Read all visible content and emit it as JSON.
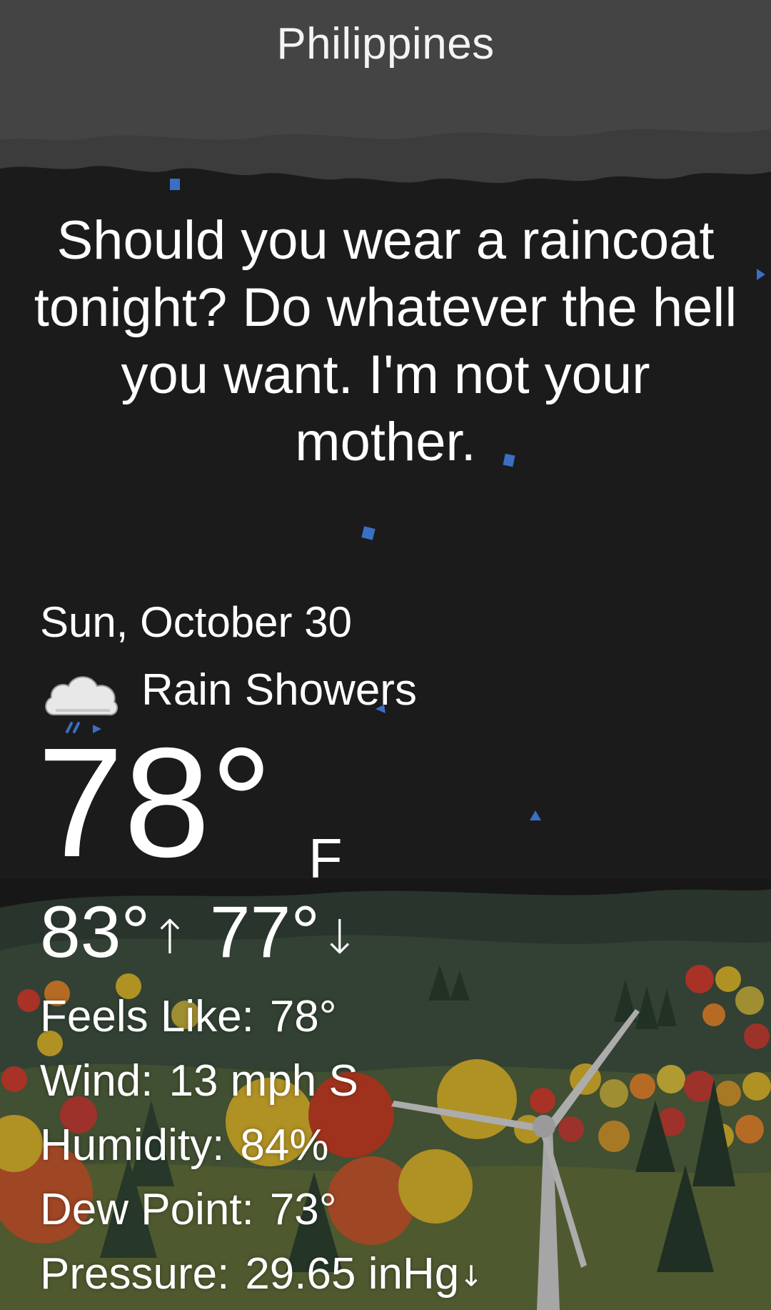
{
  "location": "Philippines",
  "headline": "Should you wear a raincoat tonight? Do whatever the hell you want. I'm not your mother.",
  "date": "Sun, October 30",
  "condition": {
    "text": "Rain Showers",
    "icon": "rain-cloud-icon"
  },
  "current": {
    "temperature": "78°",
    "unit": "F"
  },
  "high_low": {
    "high": "83°",
    "high_arrow": "↑",
    "low": "77°",
    "low_arrow": "↓"
  },
  "details": [
    {
      "label": "Feels Like:",
      "value": "78°"
    },
    {
      "label": "Wind:",
      "value": "13 mph S"
    },
    {
      "label": "Humidity:",
      "value": "84%"
    },
    {
      "label": "Dew Point:",
      "value": "73°"
    },
    {
      "label": "Pressure:",
      "value": "29.65 inHg",
      "trend": "↓"
    }
  ],
  "colors": {
    "sky": "#1b1b1b",
    "cloud_band": "#3d3d3d",
    "rain_drop": "#3a6fc4",
    "hills": "#3b4a3c",
    "ground": "#5d6636"
  }
}
